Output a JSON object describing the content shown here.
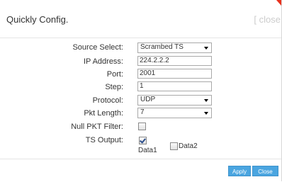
{
  "dialog": {
    "title": "Quickly Config.",
    "close_label": "close",
    "close_bracket": "["
  },
  "form": {
    "source_select": {
      "label": "Source Select:",
      "value": "Scrambed TS"
    },
    "ip_address": {
      "label": "IP Address:",
      "value": "224.2.2.2"
    },
    "port": {
      "label": "Port:",
      "value": "2001"
    },
    "step": {
      "label": "Step:",
      "value": "1"
    },
    "protocol": {
      "label": "Protocol:",
      "value": "UDP"
    },
    "pkt_length": {
      "label": "Pkt Length:",
      "value": "7"
    },
    "null_pkt_filter": {
      "label": "Null PKT Filter:",
      "checked": false
    },
    "ts_output": {
      "label": "TS Output:",
      "options": [
        {
          "label": "Data1",
          "checked": true
        },
        {
          "label": "Data2",
          "checked": false
        }
      ]
    }
  },
  "footer": {
    "apply_label": "Apply",
    "close_label": "Close"
  },
  "colors": {
    "accent": "#4aa5e0",
    "corner_mark": "#e8301c"
  }
}
